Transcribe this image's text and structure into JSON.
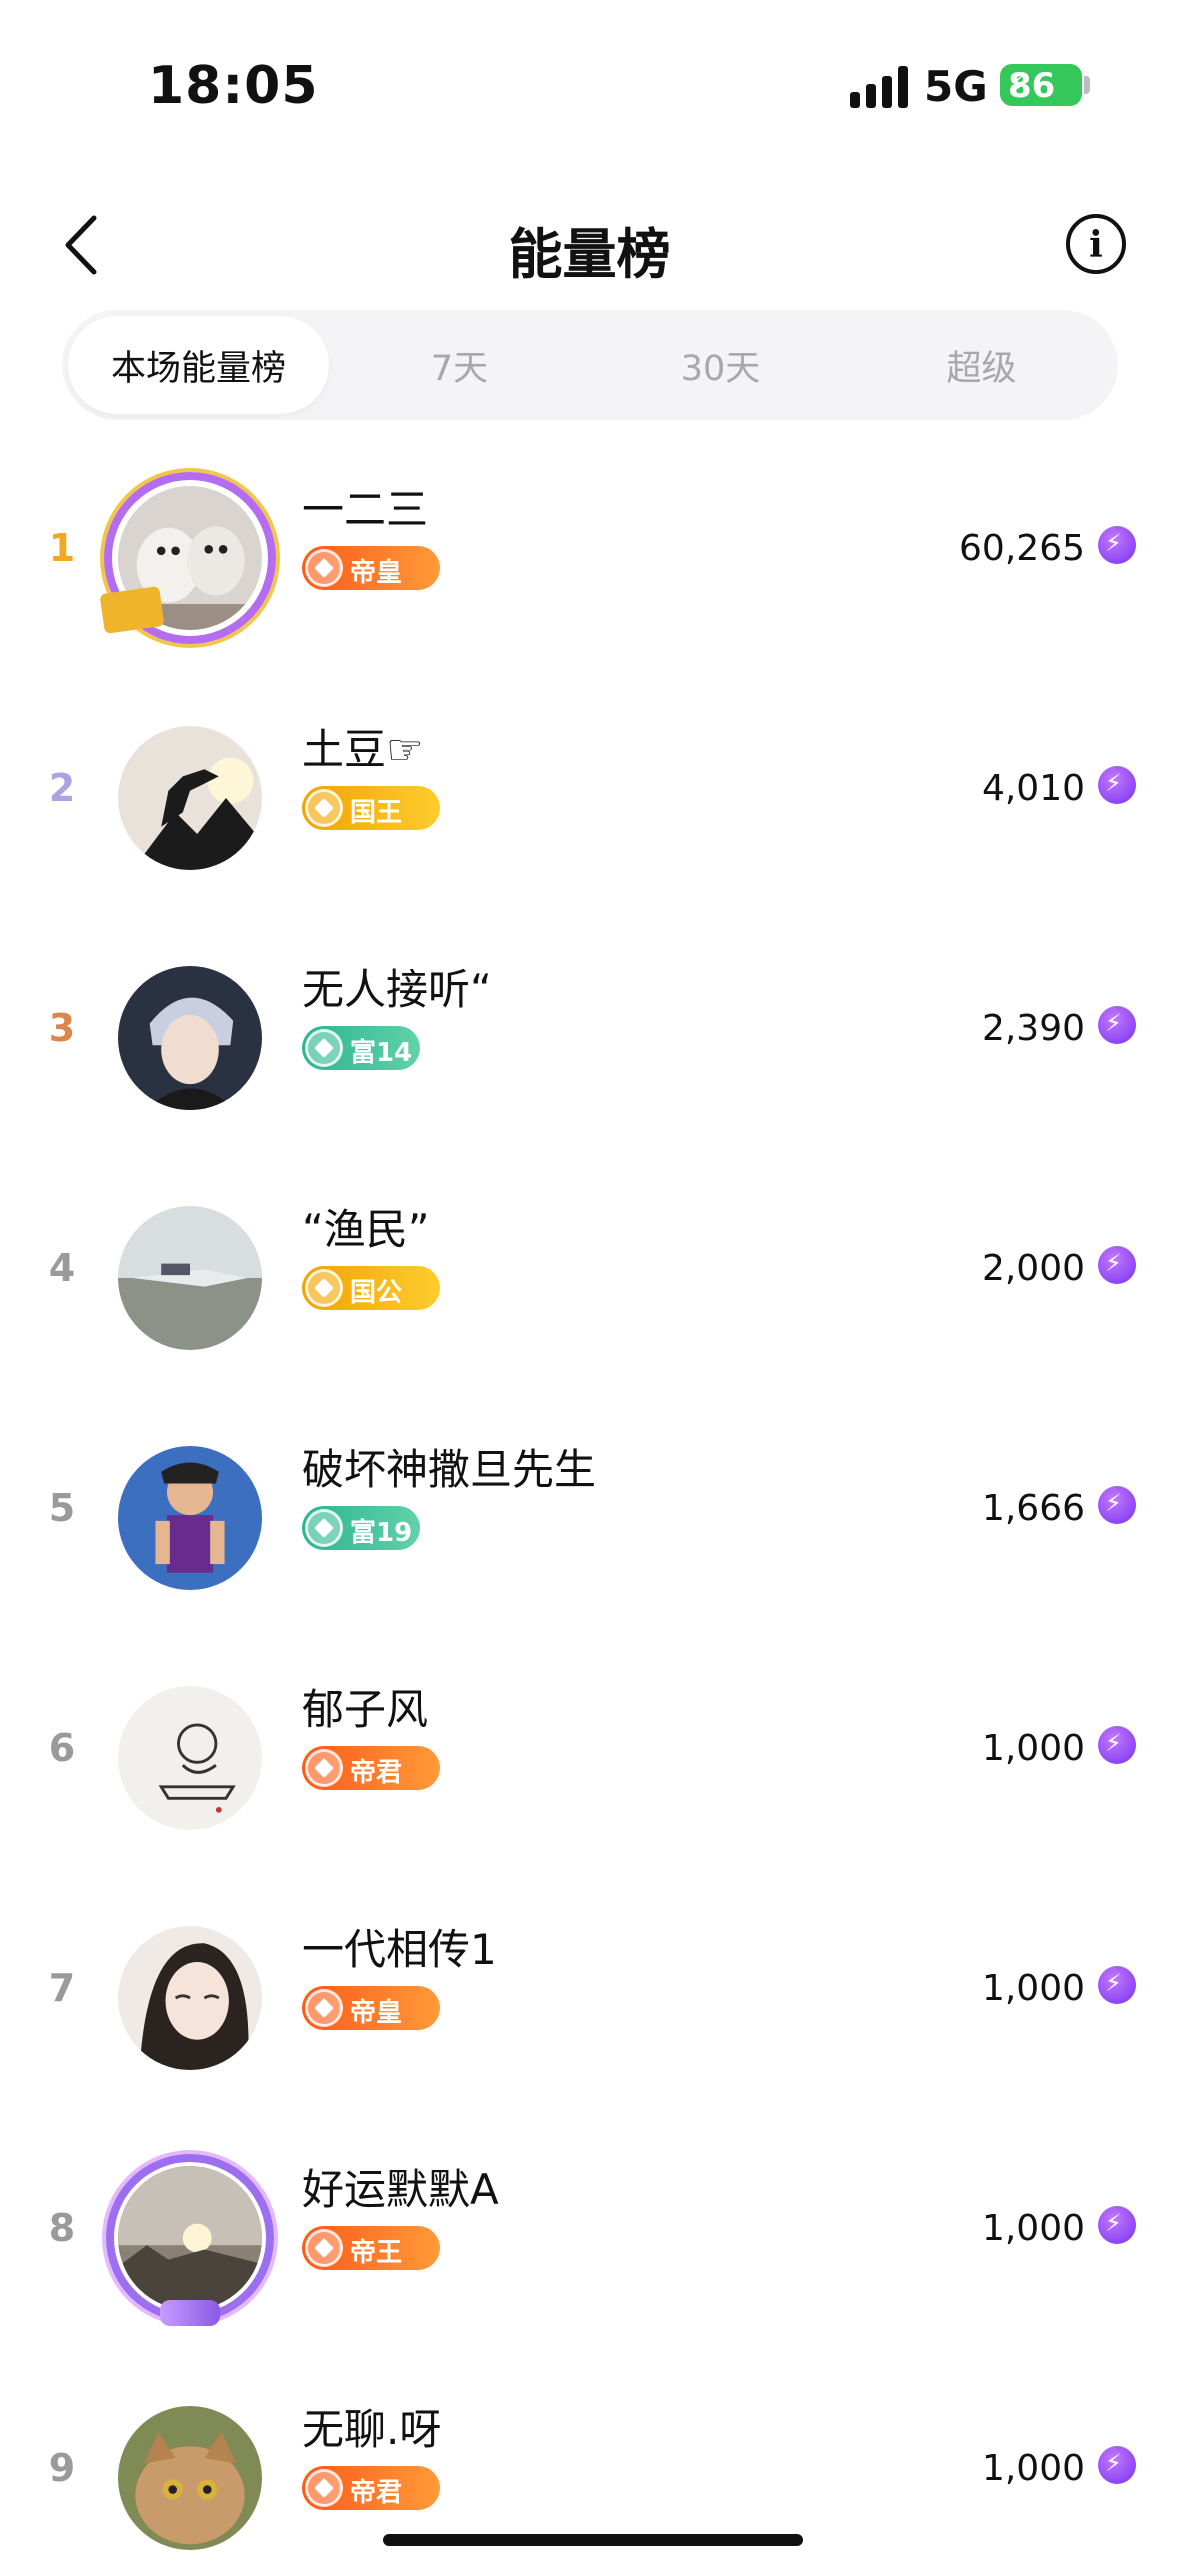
{
  "status_bar": {
    "time": "18:05",
    "network": "5G",
    "battery": "86"
  },
  "header": {
    "title": "能量榜"
  },
  "tabs": [
    {
      "label": "本场能量榜",
      "active": true
    },
    {
      "label": "7天",
      "active": false
    },
    {
      "label": "30天",
      "active": false
    },
    {
      "label": "超级",
      "active": false
    }
  ],
  "colors": {
    "rank_1": "#f5a623",
    "rank_2": "#a9a4e6",
    "rank_3": "#d9874a",
    "rank_other": "#9a9a9a",
    "energy_icon": "#8a3cf0",
    "badge_orange": "#ff6a1f",
    "badge_gold": "#f2b100",
    "badge_teal": "#32b892"
  },
  "ranking": [
    {
      "rank": "1",
      "name": "一二三",
      "badge": "帝皇",
      "badge_style": "orange",
      "value": "60,265",
      "avatar_icon": "dog-photo-avatar"
    },
    {
      "rank": "2",
      "name": "土豆☞",
      "badge": "国王",
      "badge_style": "gold",
      "value": "4,010",
      "avatar_icon": "silhouette-climbers-avatar"
    },
    {
      "rank": "3",
      "name": "无人接听“",
      "badge": "富14",
      "badge_style": "teal",
      "value": "2,390",
      "avatar_icon": "anime-boy-avatar"
    },
    {
      "rank": "4",
      "name": "“渔民”",
      "badge": "国公",
      "badge_style": "gold",
      "value": "2,000",
      "avatar_icon": "boats-lake-avatar"
    },
    {
      "rank": "5",
      "name": "破坏神撒旦先生",
      "badge": "富19",
      "badge_style": "teal",
      "value": "1,666",
      "avatar_icon": "cartoon-character-avatar"
    },
    {
      "rank": "6",
      "name": "郁子风",
      "badge": "帝君",
      "badge_style": "orange",
      "value": "1,000",
      "avatar_icon": "ink-sketch-avatar"
    },
    {
      "rank": "7",
      "name": "一代相传1",
      "badge": "帝皇",
      "badge_style": "orange",
      "value": "1,000",
      "avatar_icon": "girl-portrait-avatar"
    },
    {
      "rank": "8",
      "name": "好运默默A",
      "badge": "帝王",
      "badge_style": "orange",
      "value": "1,000",
      "avatar_icon": "sunset-landscape-avatar"
    },
    {
      "rank": "9",
      "name": "无聊.呀",
      "badge": "帝君",
      "badge_style": "orange",
      "value": "1,000",
      "avatar_icon": "cat-photo-avatar"
    }
  ]
}
